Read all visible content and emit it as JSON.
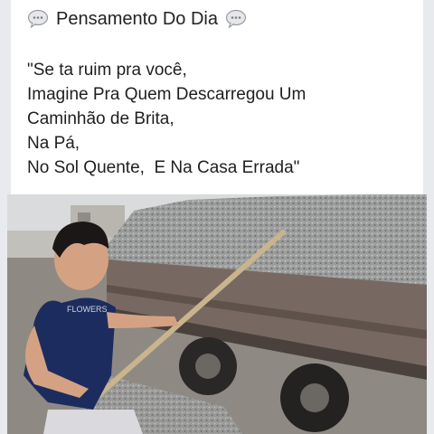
{
  "post": {
    "title": "Pensamento Do Dia",
    "quote_lines": [
      "\"Se ta ruim pra você,",
      "Imagine Pra Quem Descarregou Um",
      "Caminhão de Brita,",
      "Na Pá,",
      "No Sol Quente,  E Na Casa Errada\""
    ]
  },
  "icons": {
    "left": "speech-bubble-icon",
    "right": "speech-bubble-icon"
  },
  "photo": {
    "subject": "man-shoveling-gravel-into-truck",
    "colors": {
      "sky": "#dcdedf",
      "gravel": "#9d9f9e",
      "truck_side": "#7b6b61",
      "shirt": "#1b2a5c"
    }
  }
}
